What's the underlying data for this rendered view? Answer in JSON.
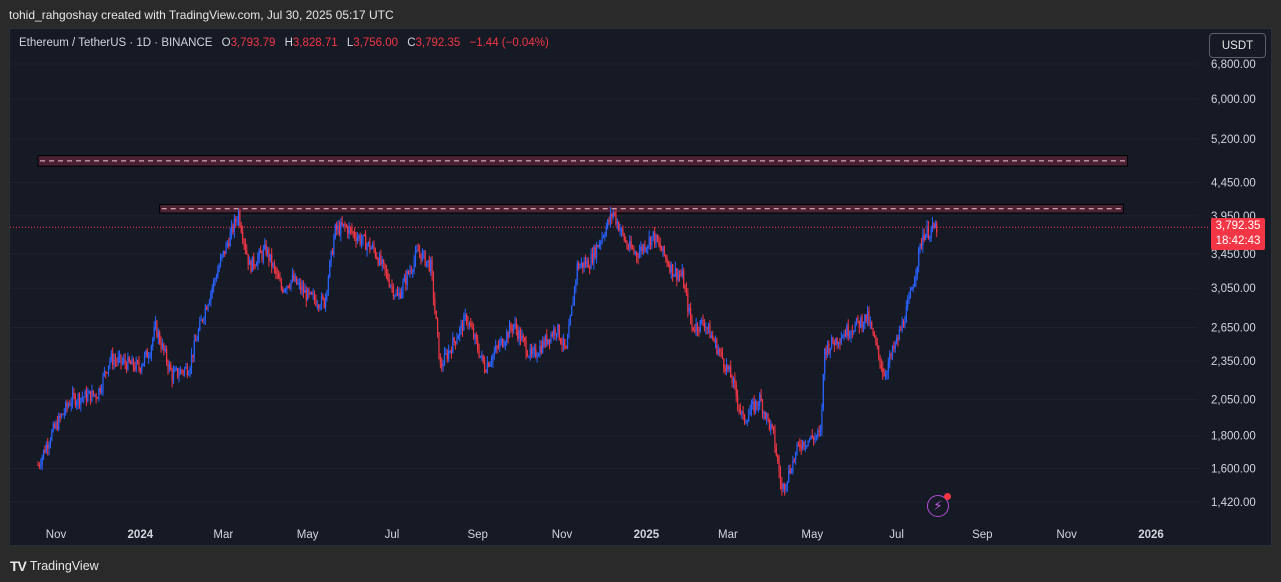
{
  "header": {
    "text": "tohid_rahgoshay created with TradingView.com, Jul 30, 2025 05:17 UTC"
  },
  "legend": {
    "symbol": "Ethereum / TetherUS · 1D · BINANCE",
    "o_label": "O",
    "o_value": "3,793.79",
    "h_label": "H",
    "h_value": "3,828.71",
    "l_label": "L",
    "l_value": "3,756.00",
    "c_label": "C",
    "c_value": "3,792.35",
    "change": "−1.44 (−0.04%)"
  },
  "currency_button": "USDT",
  "last_price": {
    "price": "3,792.35",
    "countdown": "18:42:43"
  },
  "footer": {
    "brand": "TradingView",
    "logo_icon": "tradingview-logo-icon"
  },
  "colors": {
    "background": "#161a25",
    "grid": "#1f2330",
    "up": "#2962ff",
    "down": "#f23645",
    "zone_fill": "#4a2233",
    "zone_border": "#f7c5d2",
    "text": "#d1d4dc"
  },
  "chart_data": {
    "type": "candlestick",
    "scale": "log",
    "symbol": "ETH/USDT",
    "interval": "1D",
    "y_ticks": [
      "6,800.00",
      "6,000.00",
      "5,200.00",
      "4,450.00",
      "3,950.00",
      "3,450.00",
      "3,050.00",
      "2,650.00",
      "2,350.00",
      "2,050.00",
      "1,800.00",
      "1,600.00",
      "1,420.00"
    ],
    "x_ticks": [
      "Nov",
      "2024",
      "Mar",
      "May",
      "Jul",
      "Sep",
      "Nov",
      "2025",
      "Mar",
      "May",
      "Jul",
      "Sep",
      "Nov",
      "2026"
    ],
    "ylim": [
      1360,
      7100
    ],
    "zones": [
      {
        "from": "2023-10-19",
        "to": "2025-12-15",
        "low": 4720,
        "high": 4900
      },
      {
        "from": "2024-01-15",
        "to": "2025-12-12",
        "low": 3990,
        "high": 4115
      }
    ],
    "price_line": 3792.35,
    "close_path": [
      [
        "2023-10-19",
        1620
      ],
      [
        "2023-10-28",
        1800
      ],
      [
        "2023-11-12",
        2050
      ],
      [
        "2023-12-01",
        2090
      ],
      [
        "2023-12-10",
        2370
      ],
      [
        "2023-12-31",
        2300
      ],
      [
        "2024-01-08",
        2450
      ],
      [
        "2024-01-12",
        2650
      ],
      [
        "2024-01-24",
        2230
      ],
      [
        "2024-02-05",
        2300
      ],
      [
        "2024-02-16",
        2800
      ],
      [
        "2024-02-28",
        3350
      ],
      [
        "2024-03-12",
        3990
      ],
      [
        "2024-03-20",
        3300
      ],
      [
        "2024-04-01",
        3500
      ],
      [
        "2024-04-12",
        3050
      ],
      [
        "2024-04-20",
        3150
      ],
      [
        "2024-05-02",
        2950
      ],
      [
        "2024-05-13",
        2900
      ],
      [
        "2024-05-21",
        3750
      ],
      [
        "2024-05-28",
        3800
      ],
      [
        "2024-06-18",
        3500
      ],
      [
        "2024-07-05",
        2950
      ],
      [
        "2024-07-20",
        3480
      ],
      [
        "2024-07-29",
        3300
      ],
      [
        "2024-08-05",
        2300
      ],
      [
        "2024-08-24",
        2750
      ],
      [
        "2024-09-06",
        2300
      ],
      [
        "2024-09-27",
        2680
      ],
      [
        "2024-10-10",
        2380
      ],
      [
        "2024-10-28",
        2650
      ],
      [
        "2024-11-04",
        2420
      ],
      [
        "2024-11-12",
        3300
      ],
      [
        "2024-11-21",
        3350
      ],
      [
        "2024-12-08",
        4000
      ],
      [
        "2024-12-18",
        3550
      ],
      [
        "2024-12-25",
        3450
      ],
      [
        "2025-01-06",
        3680
      ],
      [
        "2025-01-20",
        3250
      ],
      [
        "2025-01-27",
        3180
      ],
      [
        "2025-02-03",
        2650
      ],
      [
        "2025-02-12",
        2700
      ],
      [
        "2025-02-24",
        2400
      ],
      [
        "2025-03-04",
        2200
      ],
      [
        "2025-03-12",
        1900
      ],
      [
        "2025-03-24",
        2050
      ],
      [
        "2025-04-03",
        1800
      ],
      [
        "2025-04-09",
        1480
      ],
      [
        "2025-04-22",
        1750
      ],
      [
        "2025-05-07",
        1810
      ],
      [
        "2025-05-10",
        2450
      ],
      [
        "2025-05-24",
        2600
      ],
      [
        "2025-06-10",
        2750
      ],
      [
        "2025-06-22",
        2240
      ],
      [
        "2025-07-02",
        2550
      ],
      [
        "2025-07-10",
        2900
      ],
      [
        "2025-07-20",
        3700
      ],
      [
        "2025-07-30",
        3792
      ]
    ]
  }
}
